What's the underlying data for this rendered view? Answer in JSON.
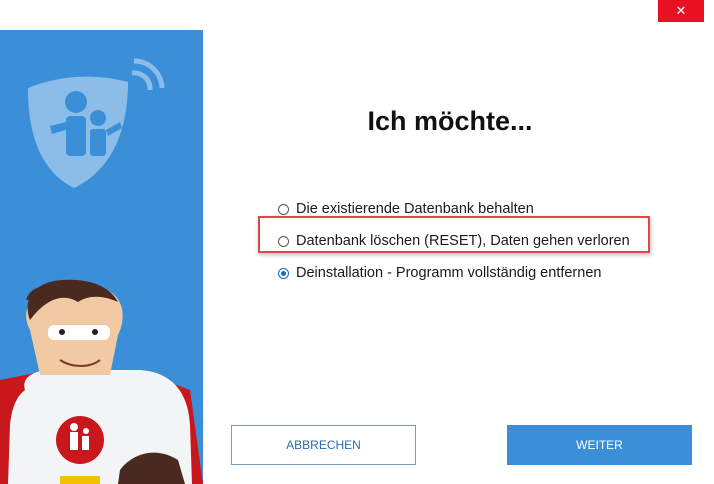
{
  "window": {
    "close_glyph": "✕"
  },
  "dialog": {
    "title": "Ich möchte..."
  },
  "options": [
    {
      "label": "Die existierende Datenbank behalten",
      "checked": false
    },
    {
      "label": "Datenbank löschen (RESET), Daten gehen verloren",
      "checked": false
    },
    {
      "label": "Deinstallation - Programm vollständig entfernen",
      "checked": true
    }
  ],
  "buttons": {
    "cancel_label": "ABBRECHEN",
    "next_label": "WEITER"
  },
  "colors": {
    "accent": "#3b8fd8",
    "close": "#e81123",
    "highlight": "#e04848",
    "radio_checked": "#1b64c7"
  }
}
